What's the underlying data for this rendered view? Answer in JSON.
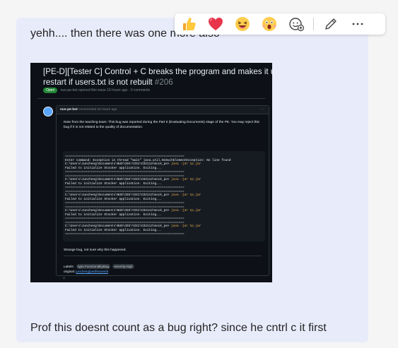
{
  "chat": {
    "message1": "yehh.... then there was one more also",
    "message2": "Prof this doesnt count as a bug right? since he cntrl c it first"
  },
  "reactions": {
    "icons": [
      "thumbs-up-icon",
      "heart-icon",
      "laugh-icon",
      "surprised-icon",
      "add-reaction-icon"
    ],
    "more_icons": [
      "edit-icon",
      "more-options-icon"
    ],
    "more_label": "···"
  },
  "screenshot": {
    "title_line1": "[PE-D][Tester C] Control + C breaks the program and makes it ur",
    "title_line2": "restart if users.txt is not rebuilt",
    "issue_number": "#206",
    "status": "Open",
    "meta": "nus-pe-bot opened this issue 16 hours ago · 0 comments",
    "comment_author": "nus-pe-bot",
    "comment_time": "commented 16 hours ago",
    "comment_menu": "···",
    "note": "Note from the teaching team: This bug was reported during the Part II (Evaluating Documents) stage of the PE. You may reject this bug if it is not related to the quality of documentation.",
    "code_lines": [
      "================================================================",
      "Enter command: Exception in thread \"main\" java.util.NoSuchElementException: No line found",
      "C:\\Users\\Juncheng\\Documents\\NUS\\CEG\\Y2S1\\CS2113\\mock_pe> java -jar tp.jar",
      "Failed to initialize Stocker application. Exiting...",
      "================================================================",
      "================================================================",
      "C:\\Users\\Juncheng\\Documents\\NUS\\CEG\\Y2S1\\CS2113\\mock_pe> java -jar tp.jar",
      "Failed to initialize Stocker application. Exiting...",
      "================================================================",
      "================================================================",
      "C:\\Users\\Juncheng\\Documents\\NUS\\CEG\\Y2S1\\CS2113\\mock_pe> java -jar tp.jar",
      "Failed to initialize Stocker application. Exiting...",
      "================================================================",
      "================================================================",
      "C:\\Users\\Juncheng\\Documents\\NUS\\CEG\\Y2S1\\CS2113\\mock_pe> java -jar tp.jar",
      "Failed to initialize Stocker application. Exiting...",
      "================================================================",
      "================================================================",
      "C:\\Users\\Juncheng\\Documents\\NUS\\CEG\\Y2S1\\CS2113\\mock_pe> java -jar tp.jar",
      "Failed to initialize Stocker application. Exiting...",
      "================================================================"
    ],
    "strange": "Strange bug, not sure why this happened.",
    "labels_label": "Labels:",
    "label1": "type.FunctionalityBug",
    "label2": "severity.High",
    "original_label": "original:",
    "original_link": "juncheng/ped/issues/8",
    "footer": "☺"
  }
}
